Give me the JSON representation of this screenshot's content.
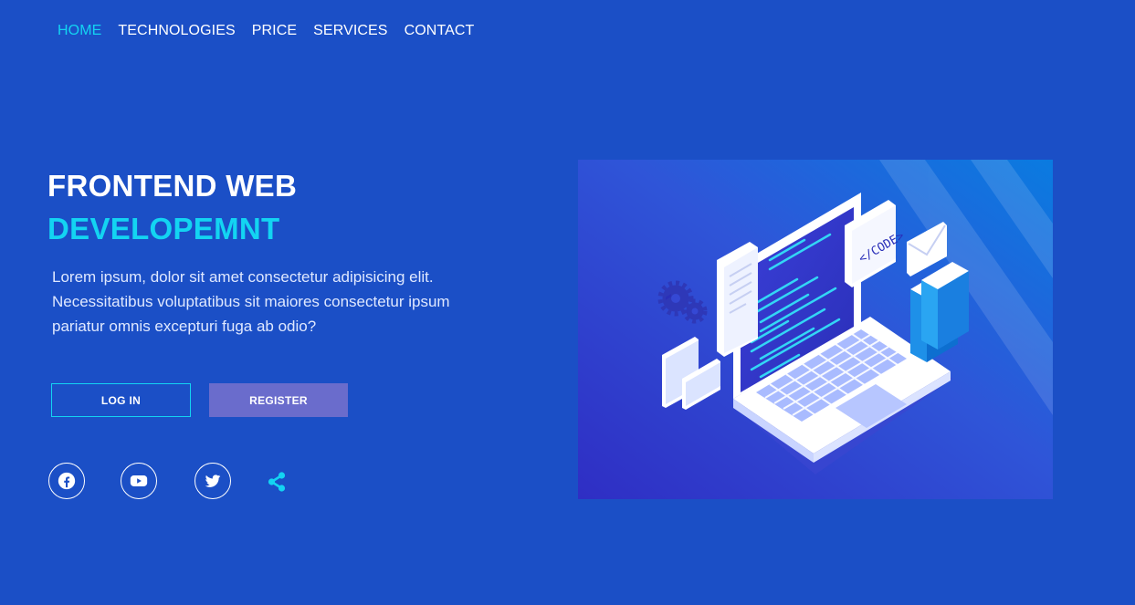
{
  "nav": {
    "items": [
      {
        "label": "HOME",
        "active": true
      },
      {
        "label": "TECHNOLOGIES",
        "active": false
      },
      {
        "label": "PRICE",
        "active": false
      },
      {
        "label": "SERVICES",
        "active": false
      },
      {
        "label": "CONTACT",
        "active": false
      }
    ]
  },
  "hero": {
    "title_line1": "FRONTEND WEB",
    "title_line2": "DEVELOPEMNT",
    "description": "Lorem ipsum, dolor sit amet consectetur adipisicing elit. Necessitatibus voluptatibus sit maiores consectetur ipsum pariatur omnis excepturi fuga ab odio?",
    "login_label": "LOG IN",
    "register_label": "REGISTER"
  },
  "illustration": {
    "code_tag": "</CODE>"
  },
  "social": {
    "icons": [
      "facebook-icon",
      "youtube-icon",
      "twitter-icon",
      "share-icon"
    ]
  },
  "colors": {
    "background": "#1b4fc6",
    "accent": "#13d4f2",
    "register_button": "#6a6ccc",
    "text": "#ffffff"
  }
}
